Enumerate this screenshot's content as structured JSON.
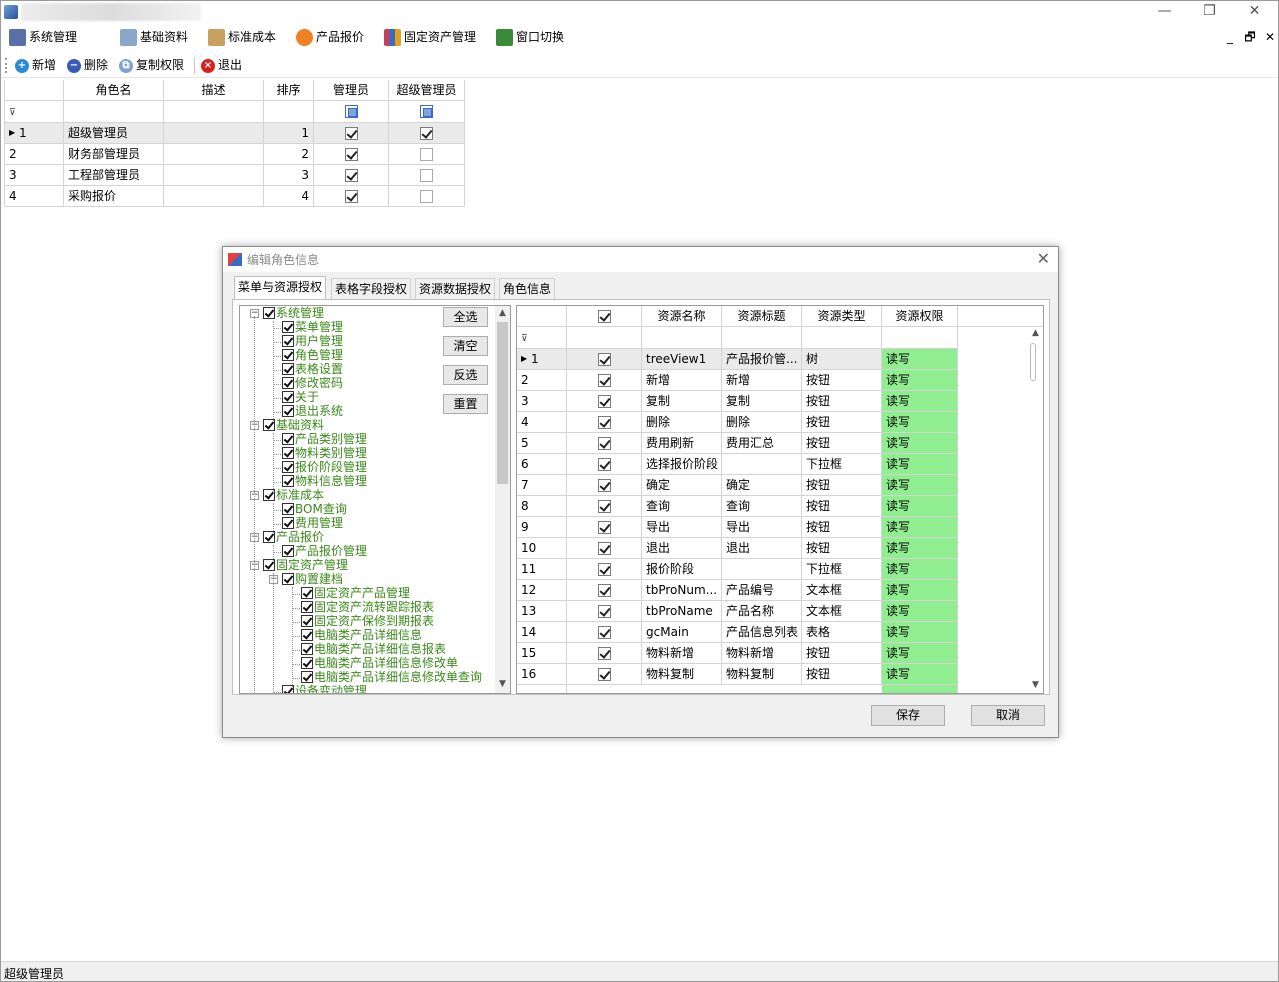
{
  "window": {
    "controls": {
      "minimize": "—",
      "restore": "❐",
      "close": "✕"
    }
  },
  "menubar": {
    "items": [
      {
        "label": "系统管理",
        "icon": "system-gear-icon",
        "color": "#5a6fa8"
      },
      {
        "label": "基础资料",
        "icon": "database-icon",
        "color": "#8aa6c8"
      },
      {
        "label": "标准成本",
        "icon": "folder-icon",
        "color": "#c8a060"
      },
      {
        "label": "产品报价",
        "icon": "price-tag-icon",
        "color": "#f08020"
      },
      {
        "label": "固定资产管理",
        "icon": "books-icon",
        "color": "#c04060"
      },
      {
        "label": "窗口切换",
        "icon": "window-switch-icon",
        "color": "#3a8a3a"
      }
    ],
    "mdi_controls": {
      "minimize": "_",
      "restore": "🗗",
      "close": "✕"
    }
  },
  "toolbar": {
    "new_label": "新增",
    "delete_label": "删除",
    "copy_perm_label": "复制权限",
    "exit_label": "退出"
  },
  "role_grid": {
    "columns": [
      "角色名",
      "描述",
      "排序",
      "管理员",
      "超级管理员"
    ],
    "rows": [
      {
        "no": "1",
        "name": "超级管理员",
        "desc": "",
        "order": "1",
        "admin": true,
        "super": true
      },
      {
        "no": "2",
        "name": "财务部管理员",
        "desc": "",
        "order": "2",
        "admin": true,
        "super": false
      },
      {
        "no": "3",
        "name": "工程部管理员",
        "desc": "",
        "order": "3",
        "admin": true,
        "super": false
      },
      {
        "no": "4",
        "name": "采购报价",
        "desc": "",
        "order": "4",
        "admin": true,
        "super": false
      }
    ]
  },
  "dialog": {
    "title": "编辑角色信息",
    "tabs": [
      "菜单与资源授权",
      "表格字段授权",
      "资源数据授权",
      "角色信息"
    ],
    "side_buttons": [
      "全选",
      "清空",
      "反选",
      "重置"
    ],
    "tree": [
      {
        "label": "系统管理",
        "level": 0
      },
      {
        "label": "菜单管理",
        "level": 1
      },
      {
        "label": "用户管理",
        "level": 1
      },
      {
        "label": "角色管理",
        "level": 1
      },
      {
        "label": "表格设置",
        "level": 1
      },
      {
        "label": "修改密码",
        "level": 1
      },
      {
        "label": "关于",
        "level": 1
      },
      {
        "label": "退出系统",
        "level": 1
      },
      {
        "label": "基础资料",
        "level": 0
      },
      {
        "label": "产品类别管理",
        "level": 1
      },
      {
        "label": "物料类别管理",
        "level": 1
      },
      {
        "label": "报价阶段管理",
        "level": 1
      },
      {
        "label": "物料信息管理",
        "level": 1
      },
      {
        "label": "标准成本",
        "level": 0
      },
      {
        "label": "BOM查询",
        "level": 1
      },
      {
        "label": "费用管理",
        "level": 1
      },
      {
        "label": "产品报价",
        "level": 0
      },
      {
        "label": "产品报价管理",
        "level": 1
      },
      {
        "label": "固定资产管理",
        "level": 0
      },
      {
        "label": "购置建档",
        "level": 1
      },
      {
        "label": "固定资产产品管理",
        "level": 2
      },
      {
        "label": "固定资产流转跟踪报表",
        "level": 2
      },
      {
        "label": "固定资产保修到期报表",
        "level": 2
      },
      {
        "label": "电脑类产品详细信息",
        "level": 2
      },
      {
        "label": "电脑类产品详细信息报表",
        "level": 2
      },
      {
        "label": "电脑类产品详细信息修改单",
        "level": 2
      },
      {
        "label": "电脑类产品详细信息修改单查询",
        "level": 2
      },
      {
        "label": "设备变动管理",
        "level": 1
      }
    ],
    "res_columns": [
      "资源名称",
      "资源标题",
      "资源类型",
      "资源权限"
    ],
    "res_rows": [
      {
        "no": "1",
        "name": "treeView1",
        "title": "产品报价管...",
        "type": "树",
        "perm": "读写"
      },
      {
        "no": "2",
        "name": "新增",
        "title": "新增",
        "type": "按钮",
        "perm": "读写"
      },
      {
        "no": "3",
        "name": "复制",
        "title": "复制",
        "type": "按钮",
        "perm": "读写"
      },
      {
        "no": "4",
        "name": "删除",
        "title": "删除",
        "type": "按钮",
        "perm": "读写"
      },
      {
        "no": "5",
        "name": "费用刷新",
        "title": "费用汇总",
        "type": "按钮",
        "perm": "读写"
      },
      {
        "no": "6",
        "name": "选择报价阶段",
        "title": "",
        "type": "下拉框",
        "perm": "读写"
      },
      {
        "no": "7",
        "name": "确定",
        "title": "确定",
        "type": "按钮",
        "perm": "读写"
      },
      {
        "no": "8",
        "name": "查询",
        "title": "查询",
        "type": "按钮",
        "perm": "读写"
      },
      {
        "no": "9",
        "name": "导出",
        "title": "导出",
        "type": "按钮",
        "perm": "读写"
      },
      {
        "no": "10",
        "name": "退出",
        "title": "退出",
        "type": "按钮",
        "perm": "读写"
      },
      {
        "no": "11",
        "name": "报价阶段",
        "title": "",
        "type": "下拉框",
        "perm": "读写"
      },
      {
        "no": "12",
        "name": "tbProNum...",
        "title": "产品编号",
        "type": "文本框",
        "perm": "读写"
      },
      {
        "no": "13",
        "name": "tbProName",
        "title": "产品名称",
        "type": "文本框",
        "perm": "读写"
      },
      {
        "no": "14",
        "name": "gcMain",
        "title": "产品信息列表",
        "type": "表格",
        "perm": "读写"
      },
      {
        "no": "15",
        "name": "物料新增",
        "title": "物料新增",
        "type": "按钮",
        "perm": "读写"
      },
      {
        "no": "16",
        "name": "物料复制",
        "title": "物料复制",
        "type": "按钮",
        "perm": "读写"
      }
    ],
    "save_label": "保存",
    "cancel_label": "取消"
  },
  "status": {
    "text": "超级管理员"
  },
  "colors": {
    "permission_bg": "#90ee90",
    "tree_text": "#3a8a1a"
  }
}
